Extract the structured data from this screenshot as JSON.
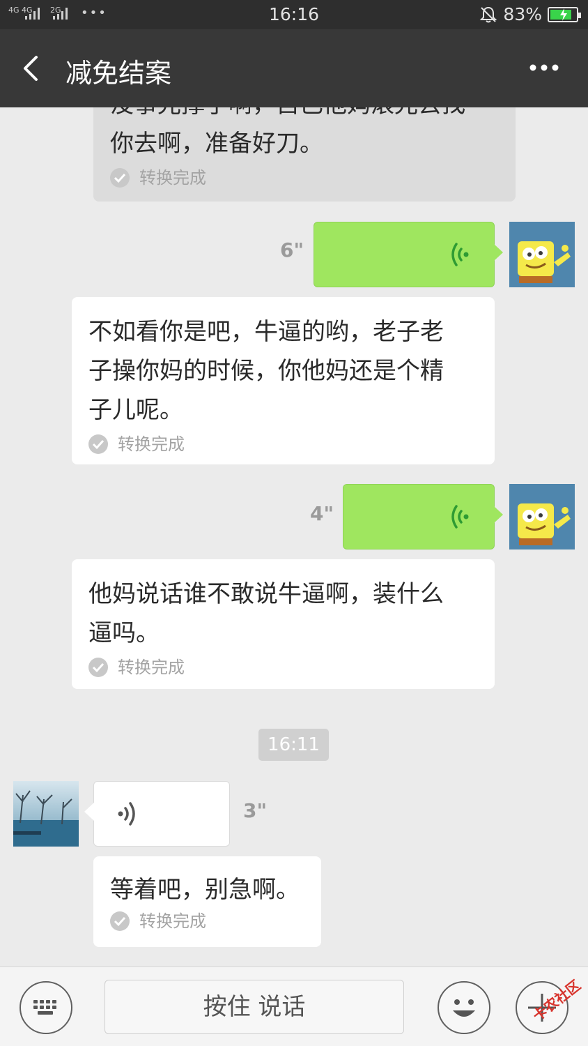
{
  "status_bar": {
    "network_left": "4G 4G",
    "network_2g": "2G",
    "dots": "•••",
    "time": "16:16",
    "battery_percent": "83%",
    "battery_level": 0.83,
    "icons": [
      "signal-icon",
      "bell-off-icon",
      "battery-charging-icon"
    ]
  },
  "header": {
    "title": "减免结案",
    "back_icon": "chevron-left-icon",
    "more_icon": "more-dots-icon"
  },
  "messages": [
    {
      "type": "text-transcript",
      "side": "left",
      "line_cut": "没事光撑了啊，自己他妈滚光去找",
      "line": "你去啊，准备好刀。",
      "status": "转换完成"
    },
    {
      "type": "voice",
      "side": "right",
      "duration": "6\""
    },
    {
      "type": "text-transcript",
      "side": "left",
      "lines": [
        "不如看你是吧，牛逼的哟，老子老",
        "子操你妈的时候，你他妈还是个精",
        "子儿呢。"
      ],
      "status": "转换完成"
    },
    {
      "type": "voice",
      "side": "right",
      "duration": "4\""
    },
    {
      "type": "text-transcript",
      "side": "left",
      "lines": [
        "他妈说话谁不敢说牛逼啊，装什么",
        "逼吗。"
      ],
      "status": "转换完成"
    },
    {
      "type": "time",
      "value": "16:11"
    },
    {
      "type": "voice",
      "side": "left",
      "duration": "3\""
    },
    {
      "type": "text-transcript",
      "side": "left",
      "lines": [
        "等着吧，别急啊。"
      ],
      "status": "转换完成"
    }
  ],
  "input_bar": {
    "keyboard_icon": "keyboard-icon",
    "hold_to_talk": "按住 说话",
    "emoji_icon": "emoji-icon",
    "plus_icon": "plus-icon",
    "watermark": "卡农社区"
  },
  "colors": {
    "sent_bubble": "#9fe65f",
    "header_bg": "#383838",
    "chat_bg": "#ebebeb"
  }
}
